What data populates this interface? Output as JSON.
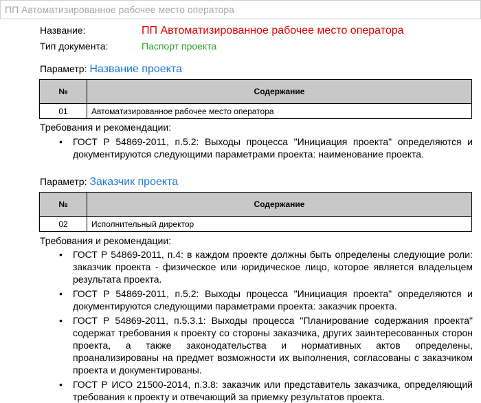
{
  "window": {
    "title": "ПП Автоматизированное рабочее место оператора"
  },
  "meta": {
    "name_label": "Название:",
    "name_value": "ПП Автоматизированное рабочее место оператора",
    "type_label": "Тип документа:",
    "type_value": "Паспорт проекта"
  },
  "colors": {
    "name_value": "#e00000",
    "type_value": "#2aa52a",
    "param_name": "#1f7ad1",
    "table_header_bg": "#c8c8c8"
  },
  "sections": [
    {
      "param_label": "Параметр:",
      "param_name": "Название проекта",
      "table": {
        "headers": [
          "№",
          "Содержание"
        ],
        "rows": [
          [
            "01",
            "Автоматизированное рабочее место оператора"
          ]
        ]
      },
      "requirements_label": "Требования и рекомендации:",
      "requirements": [
        "ГОСТ Р 54869-2011, п.5.2: Выходы процесса \"Инициация проекта\" определяются и документируются следующими параметрами проекта: наименование проекта."
      ]
    },
    {
      "param_label": "Параметр:",
      "param_name": "Заказчик проекта",
      "table": {
        "headers": [
          "№",
          "Содержание"
        ],
        "rows": [
          [
            "02",
            "Исполнительный директор"
          ]
        ]
      },
      "requirements_label": "Требования и рекомендации:",
      "requirements": [
        "ГОСТ Р 54869-2011, п.4: в каждом проекте должны быть определены следующие роли: заказчик проекта - физическое или юридическое лицо, которое является владельцем результата проекта.",
        "ГОСТ Р 54869-2011, п.5.2: Выходы процесса \"Инициация проекта\" определяются и документируются следующими параметрами проекта: заказчик проекта.",
        "ГОСТ Р 54869-2011, п.5.3.1: Выходы процесса \"Планирование содержания проекта\" содержат требования к проекту со стороны заказчика, других заинтересованных сторон проекта, а также законодательства и нормативных актов определены, проанализированы на предмет возможности их выполнения, согласованы с заказчиком проекта и документированы.",
        "ГОСТ Р ИСО 21500-2014, п.3.8: заказчик или представитель заказчика, определяющий требования к проекту и отвечающий за приемку результатов проекта."
      ]
    }
  ]
}
